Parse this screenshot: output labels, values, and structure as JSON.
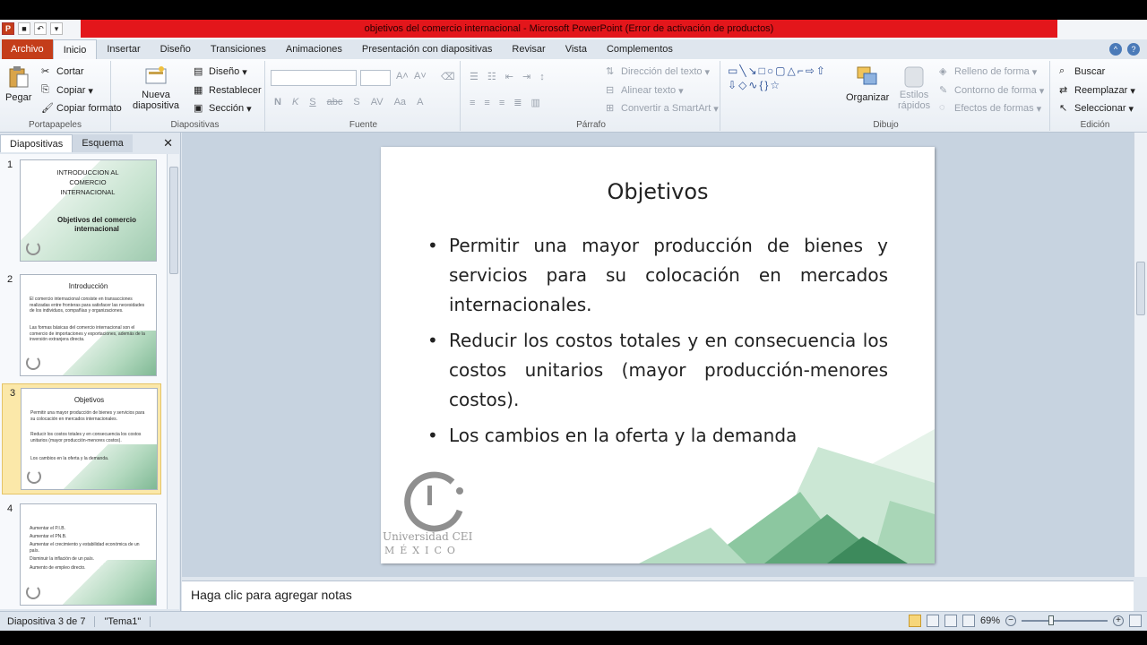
{
  "window": {
    "title": "objetivos del comercio internacional  -  Microsoft PowerPoint (Error de activación de productos)"
  },
  "tabs": [
    {
      "label": "Archivo"
    },
    {
      "label": "Inicio"
    },
    {
      "label": "Insertar"
    },
    {
      "label": "Diseño"
    },
    {
      "label": "Transiciones"
    },
    {
      "label": "Animaciones"
    },
    {
      "label": "Presentación con diapositivas"
    },
    {
      "label": "Revisar"
    },
    {
      "label": "Vista"
    },
    {
      "label": "Complementos"
    }
  ],
  "ribbon": {
    "portapapeles": {
      "label": "Portapapeles",
      "pegar": "Pegar",
      "cortar": "Cortar",
      "copiar": "Copiar",
      "copiar_formato": "Copiar formato"
    },
    "diapositivas": {
      "label": "Diapositivas",
      "nueva_1": "Nueva",
      "nueva_2": "diapositiva",
      "diseno": "Diseño",
      "restablecer": "Restablecer",
      "seccion": "Sección"
    },
    "fuente": {
      "label": "Fuente"
    },
    "parrafo": {
      "label": "Párrafo",
      "direccion": "Dirección del texto",
      "alinear": "Alinear texto",
      "smartart": "Convertir a SmartArt"
    },
    "dibujo": {
      "label": "Dibujo",
      "organizar": "Organizar",
      "estilos_1": "Estilos",
      "estilos_2": "rápidos",
      "relleno": "Relleno de forma",
      "contorno": "Contorno de forma",
      "efectos": "Efectos de formas"
    },
    "edicion": {
      "label": "Edición",
      "buscar": "Buscar",
      "reemplazar": "Reemplazar",
      "seleccionar": "Seleccionar"
    }
  },
  "left_panel": {
    "tab_slides": "Diapositivas",
    "tab_outline": "Esquema",
    "thumbnails": [
      {
        "num": "1",
        "title": "INTRODUCCION AL COMERCIO INTERNACIONAL",
        "subtitle": "Objetivos del comercio internacional"
      },
      {
        "num": "2",
        "title": "Introducción",
        "body": [
          "El comercio internacional consiste en transacciones realizadas entre fronteras para satisfacer las necesidades de los individuos, compañías y organizaciones.",
          "Las formas básicas del comercio internacional son el comercio de importaciones y exportaciones, además de la inversión extranjera directa."
        ]
      },
      {
        "num": "3",
        "title": "Objetivos",
        "body": [
          "Permitir una mayor producción de bienes y servicios para su colocación en mercados internacionales.",
          "Reducir los costos totales y en consecuencia los costos unitarios (mayor producción-menores costos).",
          "Los cambios en la oferta y la demanda."
        ]
      },
      {
        "num": "4",
        "title": "",
        "body": [
          "Aumentar el P.I.B.",
          "Aumentar el PN.B.",
          "Aumentar el crecimiento y estabilidad económica de un país.",
          "Disminuir la inflación de un país.",
          "Aumento de empleo directo."
        ]
      }
    ]
  },
  "slide": {
    "title": "Objetivos",
    "bullets": [
      "Permitir una mayor producción de bienes y servicios para su colocación en mercados internacionales.",
      "Reducir los costos totales y en consecuencia los costos unitarios (mayor producción-menores costos).",
      "Los cambios en la oferta y la demanda"
    ],
    "logo_name": "Universidad CEI",
    "logo_sub": "MÉXICO"
  },
  "notes": {
    "placeholder": "Haga clic para agregar notas"
  },
  "status": {
    "slide_info": "Diapositiva 3 de 7",
    "theme": "\"Tema1\"",
    "zoom": "69%",
    "zoom_fraction": 0.69
  },
  "colors": {
    "title_bar_red": "#e3161b",
    "file_tab": "#c43d1a",
    "selection": "#fbe8a9",
    "accent_green": "#5fa77a"
  }
}
